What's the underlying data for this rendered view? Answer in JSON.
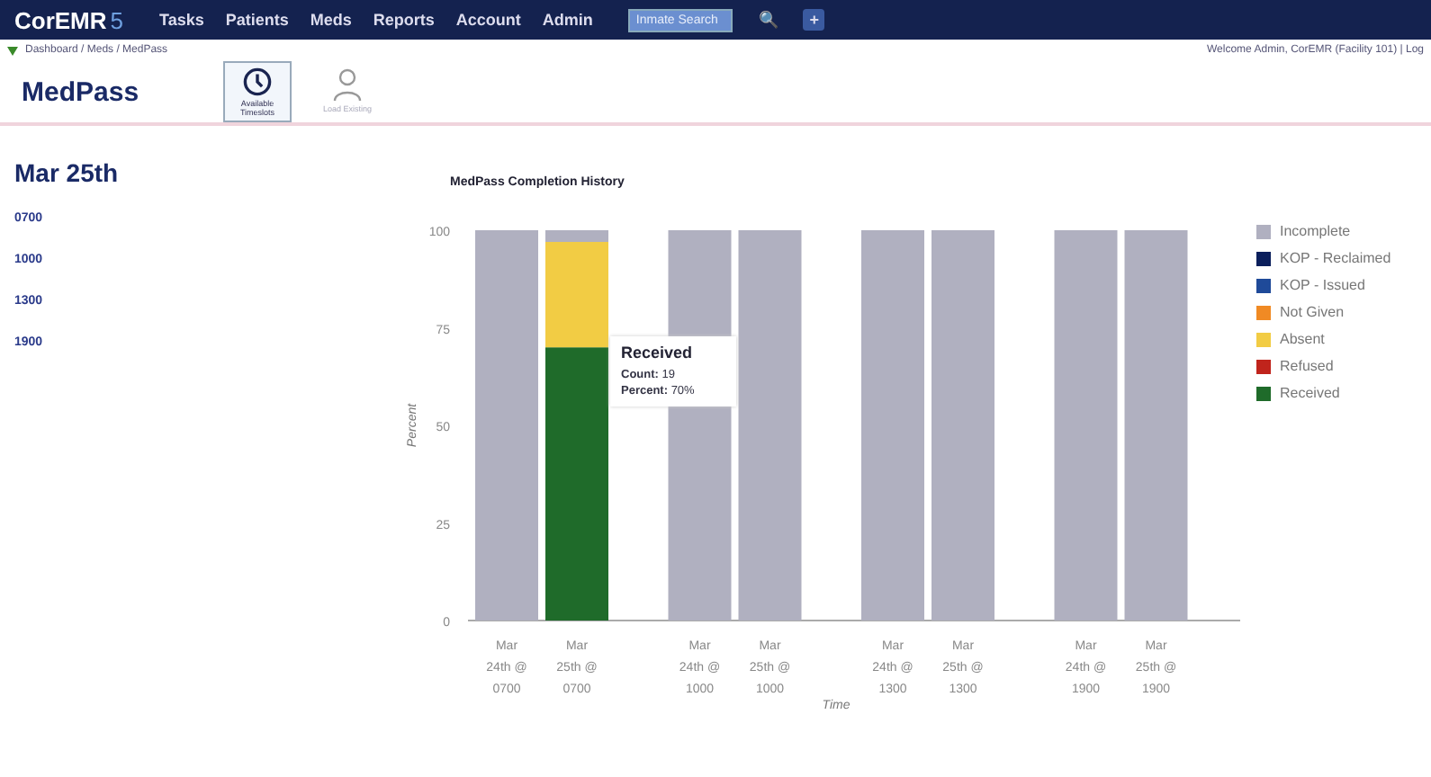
{
  "navbar": {
    "logo": "CorEMR",
    "logo_version": "5",
    "menu": [
      "Tasks",
      "Patients",
      "Meds",
      "Reports",
      "Account",
      "Admin"
    ],
    "search": {
      "placeholder": "Inmate Search"
    },
    "search_button": "🔍",
    "add_button": "+"
  },
  "breadcrumb": "Dashboard / Meds / MedPass",
  "welcome": "Welcome Admin, CorEMR (Facility 101) | Log",
  "page_title": "MedPass",
  "tools": [
    {
      "label": "Available Timeslots",
      "selected": true,
      "kind": "clock"
    },
    {
      "label": "Load Existing",
      "selected": false,
      "kind": "person"
    }
  ],
  "date_heading": "Mar 25th",
  "timeslots": [
    "0700",
    "1000",
    "1300",
    "1900"
  ],
  "chart": {
    "chart_data": {
      "type": "bar",
      "stacked": true,
      "title": "MedPass Completion History",
      "xlabel": "Time",
      "ylabel": "Percent",
      "ylim": [
        0,
        100
      ],
      "yticks": [
        0,
        25,
        50,
        75,
        100
      ],
      "categories": [
        "Mar 24th @ 0700",
        "Mar 25th @ 0700",
        "Mar 24th @ 1000",
        "Mar 25th @ 1000",
        "Mar 24th @ 1300",
        "Mar 25th @ 1300",
        "Mar 24th @ 1900",
        "Mar 25th @ 1900"
      ],
      "series": [
        {
          "name": "Incomplete",
          "color": "#b0b0c0",
          "values": [
            100,
            3,
            100,
            100,
            100,
            100,
            100,
            100
          ]
        },
        {
          "name": "KOP - Reclaimed",
          "color": "#0b1f5c",
          "values": [
            0,
            0,
            0,
            0,
            0,
            0,
            0,
            0
          ]
        },
        {
          "name": "KOP - Issued",
          "color": "#1f4a99",
          "values": [
            0,
            0,
            0,
            0,
            0,
            0,
            0,
            0
          ]
        },
        {
          "name": "Not Given",
          "color": "#f08a24",
          "values": [
            0,
            0,
            0,
            0,
            0,
            0,
            0,
            0
          ]
        },
        {
          "name": "Absent",
          "color": "#f2cc44",
          "values": [
            0,
            27,
            0,
            0,
            0,
            0,
            0,
            0
          ]
        },
        {
          "name": "Refused",
          "color": "#c0241c",
          "values": [
            0,
            0,
            0,
            0,
            0,
            0,
            0,
            0
          ]
        },
        {
          "name": "Received",
          "color": "#1f6b2a",
          "values": [
            0,
            70,
            0,
            0,
            0,
            0,
            0,
            0
          ]
        }
      ]
    },
    "tooltip": {
      "title": "Received",
      "lines": [
        {
          "label": "Count:",
          "value": "19"
        },
        {
          "label": "Percent:",
          "value": "70%"
        }
      ]
    }
  }
}
